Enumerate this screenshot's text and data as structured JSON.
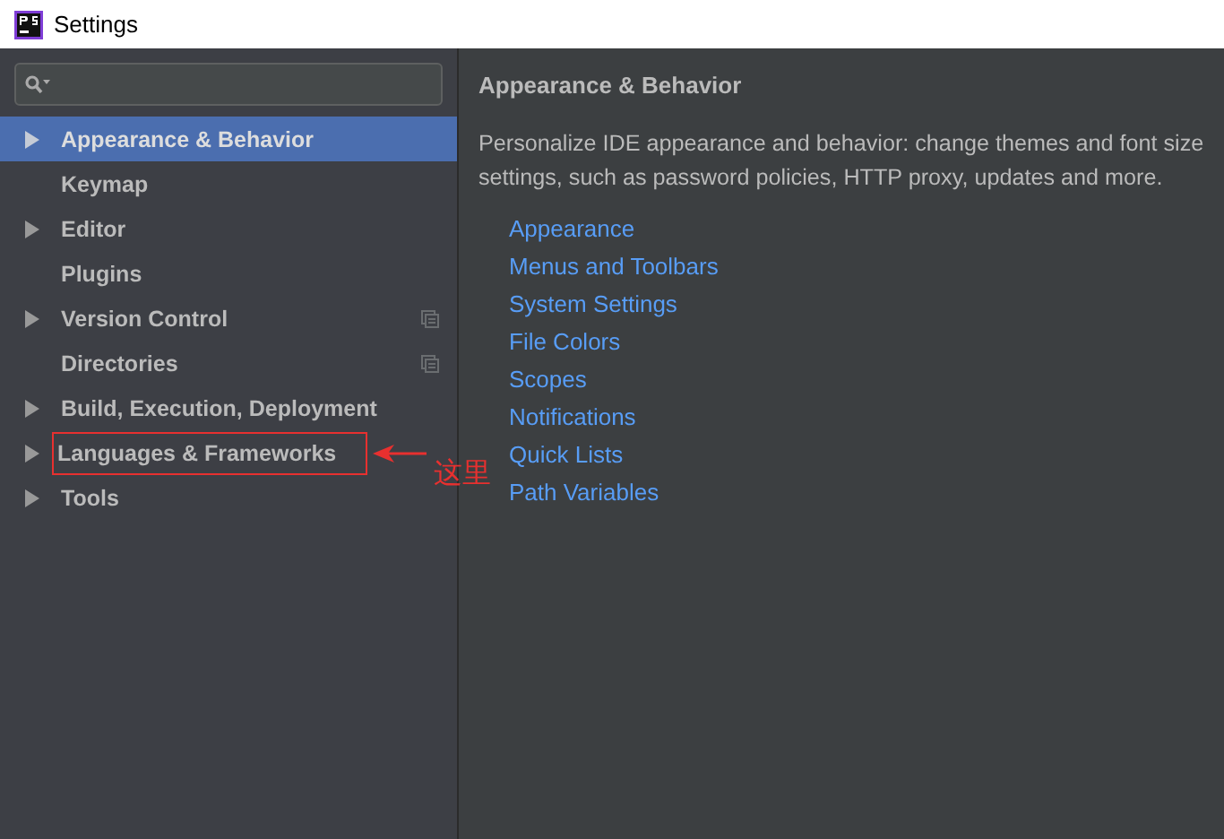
{
  "window": {
    "title": "Settings"
  },
  "sidebar": {
    "items": [
      {
        "label": "Appearance & Behavior",
        "expandable": true,
        "selected": true,
        "project_scoped": false,
        "annotated": false
      },
      {
        "label": "Keymap",
        "expandable": false,
        "selected": false,
        "project_scoped": false,
        "annotated": false
      },
      {
        "label": "Editor",
        "expandable": true,
        "selected": false,
        "project_scoped": false,
        "annotated": false
      },
      {
        "label": "Plugins",
        "expandable": false,
        "selected": false,
        "project_scoped": false,
        "annotated": false
      },
      {
        "label": "Version Control",
        "expandable": true,
        "selected": false,
        "project_scoped": true,
        "annotated": false
      },
      {
        "label": "Directories",
        "expandable": false,
        "selected": false,
        "project_scoped": true,
        "annotated": false
      },
      {
        "label": "Build, Execution, Deployment",
        "expandable": true,
        "selected": false,
        "project_scoped": false,
        "annotated": false
      },
      {
        "label": "Languages & Frameworks",
        "expandable": true,
        "selected": false,
        "project_scoped": false,
        "annotated": true
      },
      {
        "label": "Tools",
        "expandable": true,
        "selected": false,
        "project_scoped": false,
        "annotated": false
      }
    ]
  },
  "annotation": {
    "text": "这里"
  },
  "content": {
    "title": "Appearance & Behavior",
    "description": "Personalize IDE appearance and behavior: change themes and font size\nsettings, such as password policies, HTTP proxy, updates and more.",
    "links": [
      "Appearance",
      "Menus and Toolbars",
      "System Settings",
      "File Colors",
      "Scopes",
      "Notifications",
      "Quick Lists",
      "Path Variables"
    ]
  }
}
